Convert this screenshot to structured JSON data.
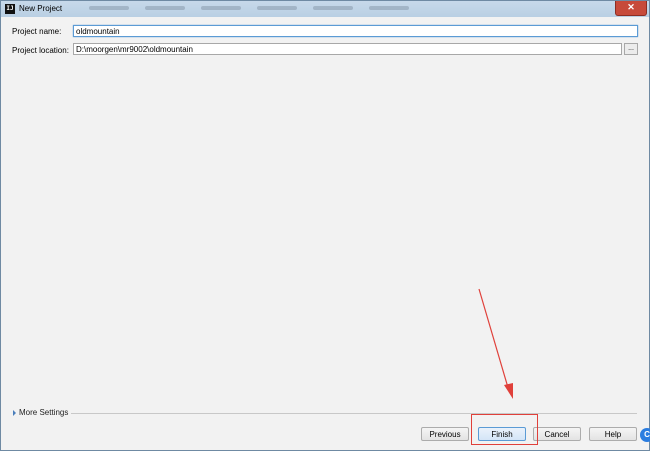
{
  "window": {
    "title": "New Project",
    "app_icon_text": "IJ"
  },
  "form": {
    "project_name_label": "Project name:",
    "project_name_value": "oldmountain",
    "project_location_label": "Project location:",
    "project_location_value": "D:\\moorgen\\mr9002\\oldmountain",
    "browse_label": "..."
  },
  "more_settings": {
    "label": "More Settings"
  },
  "buttons": {
    "previous": "Previous",
    "finish": "Finish",
    "cancel": "Cancel",
    "help": "Help"
  },
  "colors": {
    "annotation": "#e0403a",
    "focus": "#5b9bd5",
    "background": "#f2f2f2"
  },
  "icons": {
    "app": "intellij-idea-icon",
    "expand": "triangle-right-icon",
    "corner": "blue-circle-icon"
  }
}
